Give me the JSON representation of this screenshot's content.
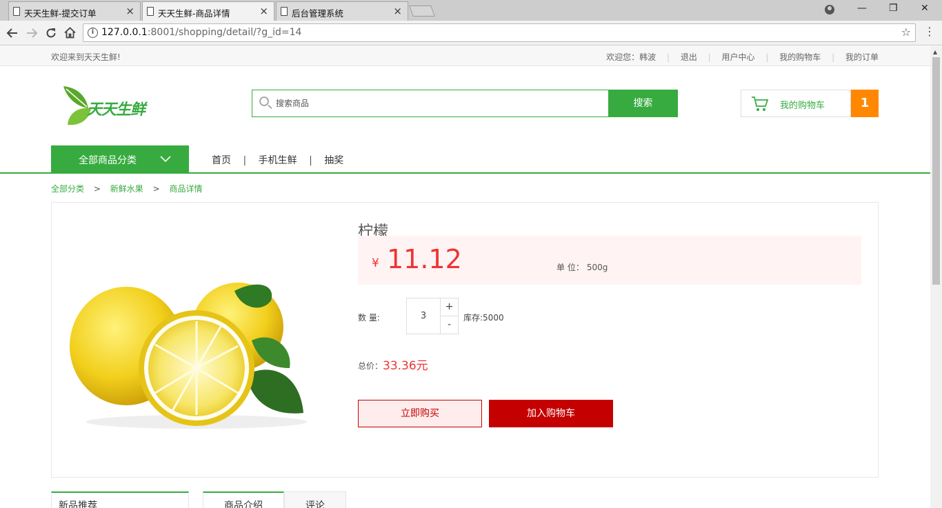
{
  "browser": {
    "tabs": [
      {
        "title": "天天生鲜-提交订单",
        "close": "×"
      },
      {
        "title": "天天生鲜-商品详情",
        "close": "×"
      },
      {
        "title": "后台管理系统",
        "close": "×"
      }
    ],
    "url_host": "127.0.0.1",
    "url_rest": ":8001/shopping/detail/?g_id=14",
    "window_controls": {
      "minimize": "—",
      "restore": "❐",
      "close": "✕"
    },
    "icons": {
      "back": "arrow-left-icon",
      "forward": "arrow-right-icon",
      "reload": "reload-icon",
      "home": "home-icon",
      "info": "info-icon",
      "bookmark": "star-icon",
      "menu": "kebab-menu-icon",
      "profile": "profile-icon"
    }
  },
  "topbar": {
    "welcome": "欢迎来到天天生鲜!",
    "greeting": "欢迎您：韩波",
    "logout": "退出",
    "user_center": "用户中心",
    "my_cart": "我的购物车",
    "my_orders": "我的订单"
  },
  "header": {
    "logo_text": "天天生鲜",
    "search_placeholder": "搜索商品",
    "search_button": "搜索",
    "cart_label": "我的购物车",
    "cart_count": "1"
  },
  "nav": {
    "category_button": "全部商品分类",
    "items": [
      "首页",
      "手机生鲜",
      "抽奖"
    ],
    "separator": "|"
  },
  "breadcrumb": {
    "items": [
      "全部分类",
      "新鲜水果",
      "商品详情"
    ],
    "separator": ">"
  },
  "product": {
    "name": "柠檬",
    "currency": "¥",
    "price": "11.12",
    "unit_label": "单 位：",
    "unit": "500g",
    "quantity_label": "数 量:",
    "quantity": "3",
    "plus": "+",
    "minus": "-",
    "stock": "库存:5000",
    "total_label": "总价：",
    "total": "33.36元",
    "buy_now": "立即购买",
    "add_to_cart": "加入购物车"
  },
  "lower": {
    "new_goods_title": "新品推荐",
    "tab_intro": "商品介绍",
    "tab_comment": "评论"
  },
  "colors": {
    "brand_green": "#37ab40",
    "price_red": "#ee3333",
    "cart_orange": "#ff8800",
    "button_red": "#c40000"
  }
}
